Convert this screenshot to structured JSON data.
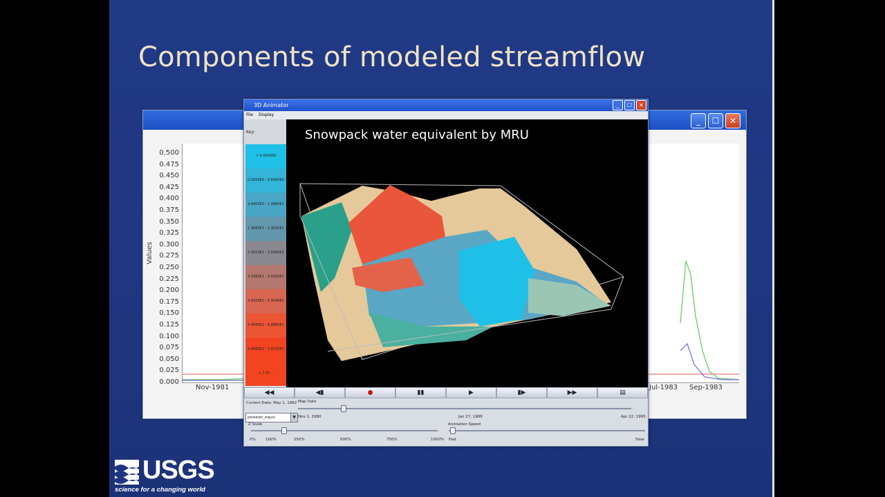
{
  "slide": {
    "title": "Components of modeled streamflow",
    "logo_text": "USGS",
    "logo_tagline": "science for a changing world"
  },
  "plot_window": {
    "y_axis_title": "Values",
    "y_ticks": [
      "0.500",
      "0.475",
      "0.450",
      "0.425",
      "0.400",
      "0.375",
      "0.350",
      "0.325",
      "0.300",
      "0.275",
      "0.250",
      "0.225",
      "0.200",
      "0.175",
      "0.150",
      "0.125",
      "0.100",
      "0.075",
      "0.050",
      "0.025",
      "0.000"
    ],
    "x_ticks": [
      "Nov-1981",
      "Jul-1983",
      "Sep-1983"
    ],
    "window_buttons": [
      "_",
      "☐",
      "✕"
    ]
  },
  "animator": {
    "title": "3D Animator",
    "menu": [
      "File",
      "Display"
    ],
    "key_label": "Key:",
    "key_colors": [
      "#1fc0e8",
      "#33b4d8",
      "#4aa6c6",
      "#6398ac",
      "#8a8890",
      "#b47870",
      "#d86650",
      "#ec5534",
      "#f24420"
    ],
    "key_entries": [
      "< 0.0000E0",
      "0.0000E0 - 9.8400E0",
      "9.8400E0 - 1.9680E1",
      "1.9680E1 - 2.9520E1",
      "2.9520E1 - 3.9360E1",
      "3.9360E1 - 4.9200E1",
      "4.9200E1 - 5.9040E1",
      "5.9040E1 - 6.8880E1",
      "6.8880E1 - 7.8720E1",
      "> 7.87..."
    ],
    "view_title": "Snowpack water equivalent by MRU",
    "controls": [
      "◀◀",
      "◀▮",
      "●",
      "▮▮",
      "▶",
      "▮▶",
      "▶▶",
      "▤"
    ],
    "current_date": "Current Date: May 1, 1982",
    "map_date_label": "Map Date",
    "variable": "pkwater_equiv",
    "date_start": "Nov 1, 1980",
    "date_mid": "Jan 27, 1988",
    "date_end": "Apr 22, 1995",
    "z_scale_label": "Z Scale",
    "z_ticks": [
      "0%",
      "100%",
      "250%",
      "500%",
      "750%",
      "1000%"
    ],
    "anim_speed_label": "Animation Speed",
    "speed_fast": "Fast",
    "speed_slow": "Slow"
  }
}
